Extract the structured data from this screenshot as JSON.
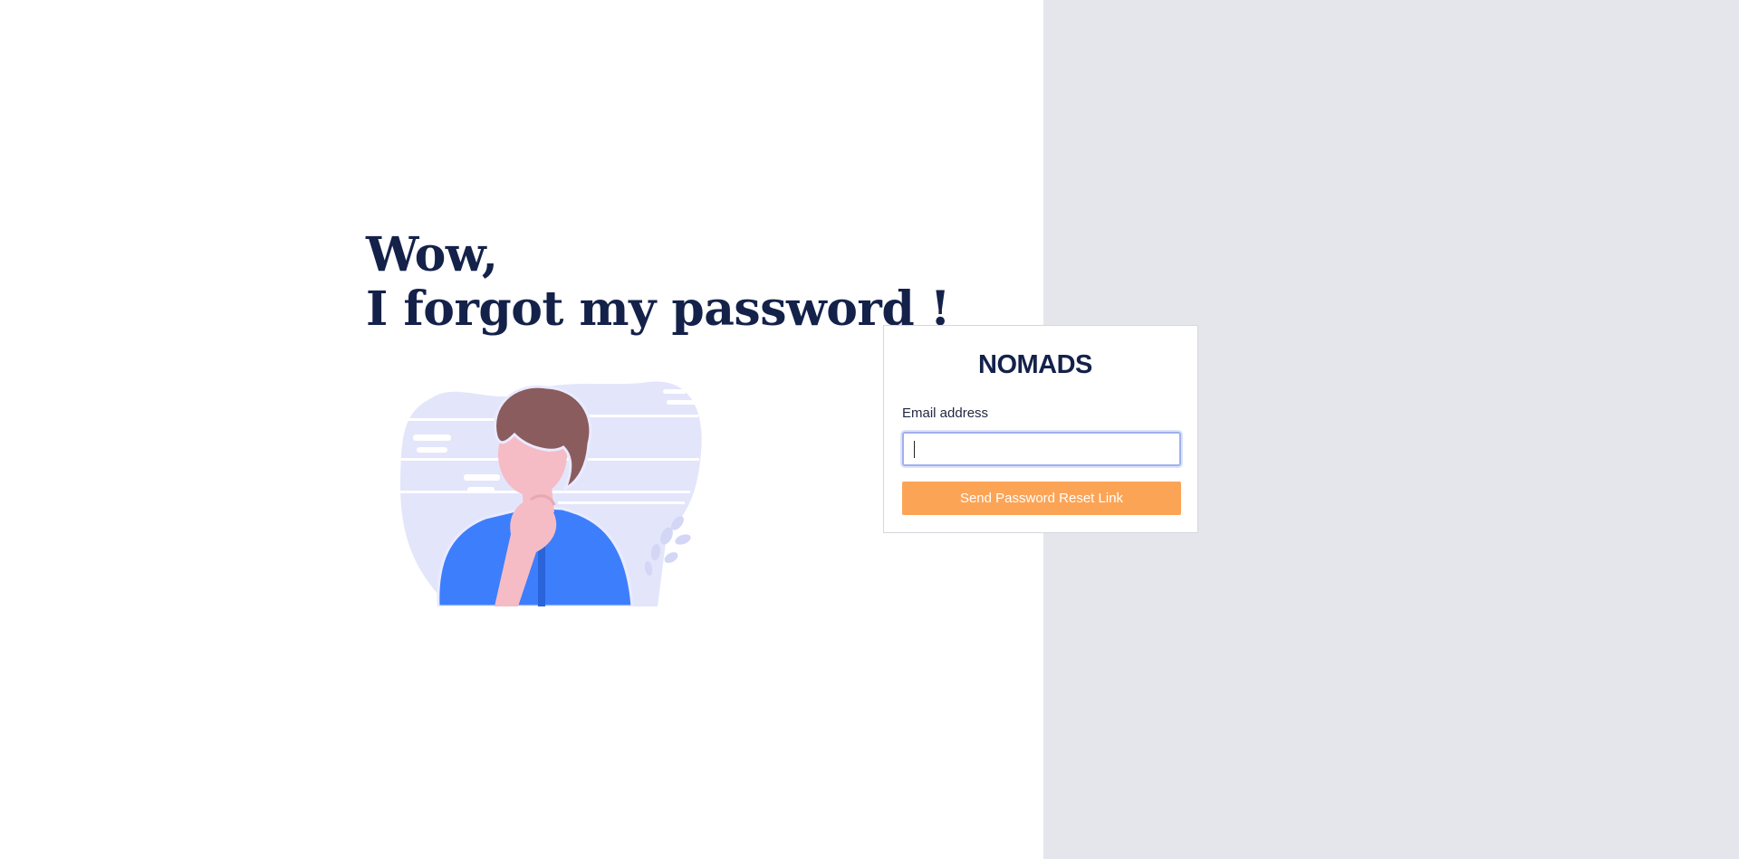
{
  "headline": {
    "line1": "Wow,",
    "line2": "I forgot my password !"
  },
  "illustration": {
    "icon": "thinking-person-illustration",
    "colors": {
      "blob": "#e3e5fb",
      "hair": "#8a5c5e",
      "skin": "#f5bcc6",
      "shirt": "#3d7efc"
    }
  },
  "card": {
    "logo_text": "NOMADS",
    "email_label": "Email address",
    "email_value": "",
    "email_placeholder": "",
    "submit_label": "Send Password Reset Link"
  },
  "colors": {
    "heading": "#14224a",
    "accent_button": "#fca456",
    "right_panel": "#e5e6eb",
    "input_focus": "#9fb0ee"
  }
}
